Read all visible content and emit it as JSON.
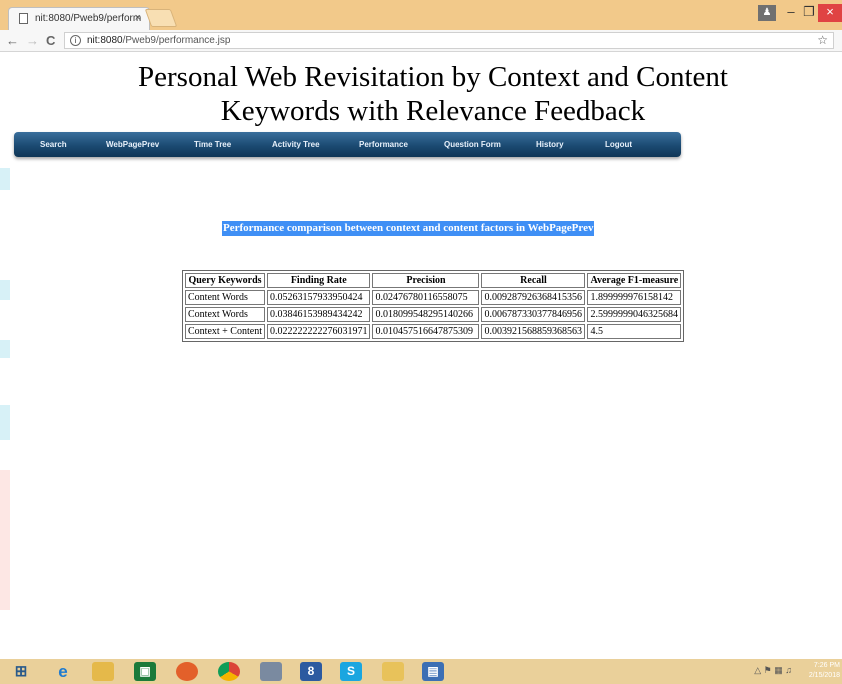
{
  "browser": {
    "tab_title": "nit:8080/Pweb9/perform",
    "tab_close": "×",
    "url_host": "nit:8080",
    "url_path": "/Pweb9/performance.jsp",
    "back": "←",
    "forward": "→",
    "reload": "C",
    "info": "i",
    "star": "☆",
    "minimize": "–",
    "restore": "❐",
    "close": "×"
  },
  "page": {
    "title_line1": "Personal Web Revisitation by Context and Content",
    "title_line2": "Keywords with Relevance Feedback",
    "menu": [
      "Search",
      "WebPagePrev",
      "Time Tree",
      "Activity Tree",
      "Performance",
      "Question Form",
      "History",
      "Logout"
    ],
    "heading": "Performance comparison between context and content factors in WebPagePrev"
  },
  "table": {
    "headers": [
      "Query Keywords",
      "Finding Rate",
      "Precision",
      "Recall",
      "Average F1-measure"
    ],
    "rows": [
      [
        "Content Words",
        "0.05263157933950424",
        "0.02476780116558075",
        "0.009287926368415356",
        "1.899999976158142"
      ],
      [
        "Context Words",
        "0.03846153989434242",
        "0.018099548295140266",
        "0.006787330377846956",
        "2.5999999046325684"
      ],
      [
        "Context + Content",
        "0.022222222276031971",
        "0.010457516647875309",
        "0.003921568859368563",
        "4.5"
      ]
    ]
  },
  "taskbar": {
    "clock_time": "7:26 PM",
    "clock_date": "2/15/2018",
    "icons": [
      "windows-start-icon",
      "ie-icon",
      "file-explorer-icon",
      "store-icon",
      "firefox-icon",
      "chrome-icon",
      "app-icon",
      "app-8-icon",
      "skype-icon",
      "folder-icon",
      "editor-icon"
    ]
  }
}
